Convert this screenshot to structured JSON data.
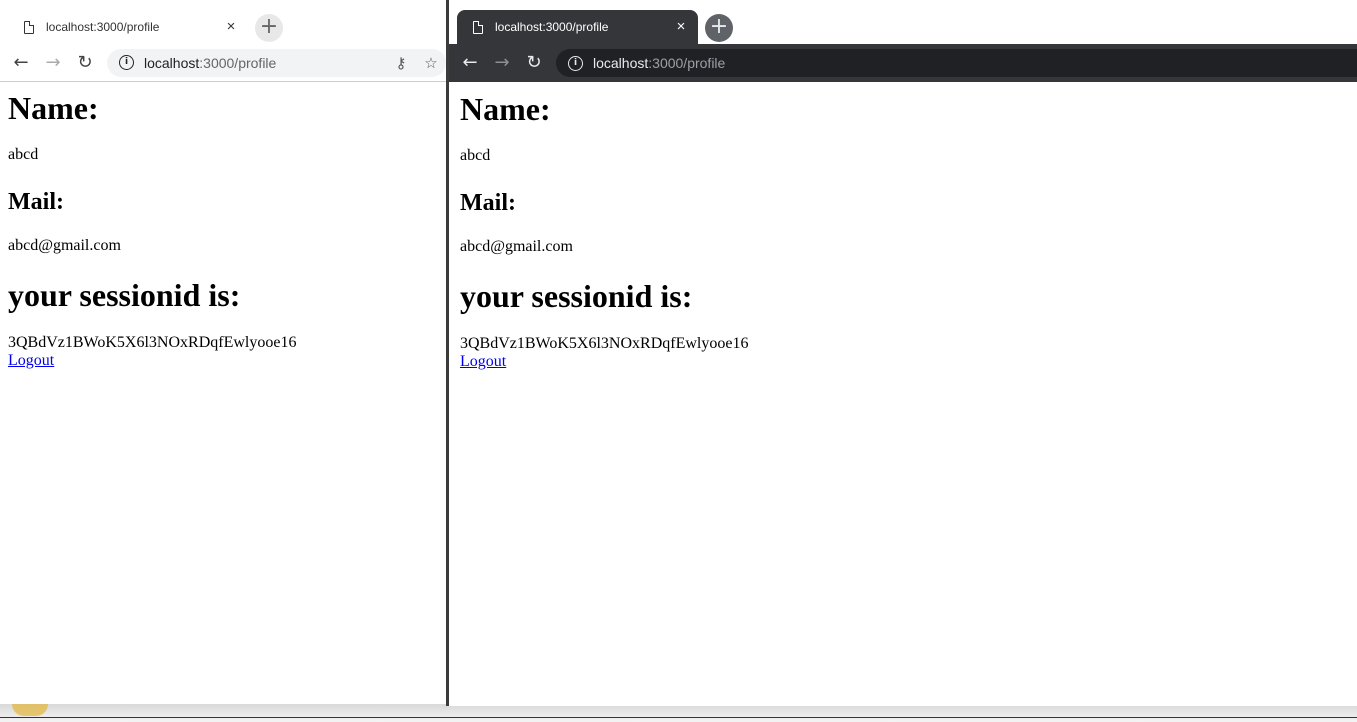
{
  "windows": {
    "left": {
      "tab_title": "localhost:3000/profile",
      "url_host": "localhost",
      "url_path": ":3000/profile"
    },
    "right": {
      "tab_title": "localhost:3000/profile",
      "url_host": "localhost",
      "url_path": ":3000/profile"
    }
  },
  "profile": {
    "name_heading": "Name:",
    "name_value": "abcd",
    "mail_heading": "Mail:",
    "mail_value": "abcd@gmail.com",
    "session_heading": "your sessionid is:",
    "session_value": "3QBdVz1BWoK5X6l3NOxRDqfEwlyooe16",
    "logout_label": "Logout"
  },
  "icons": {
    "close": "×",
    "new_tab": "+",
    "back": "←",
    "forward": "→",
    "reload": "↻",
    "info": "i",
    "key": "⚷",
    "star": "☆"
  },
  "colors": {
    "link": "#0000ee",
    "dark_toolbar": "#35363a",
    "light_toolbar": "#ffffff"
  }
}
